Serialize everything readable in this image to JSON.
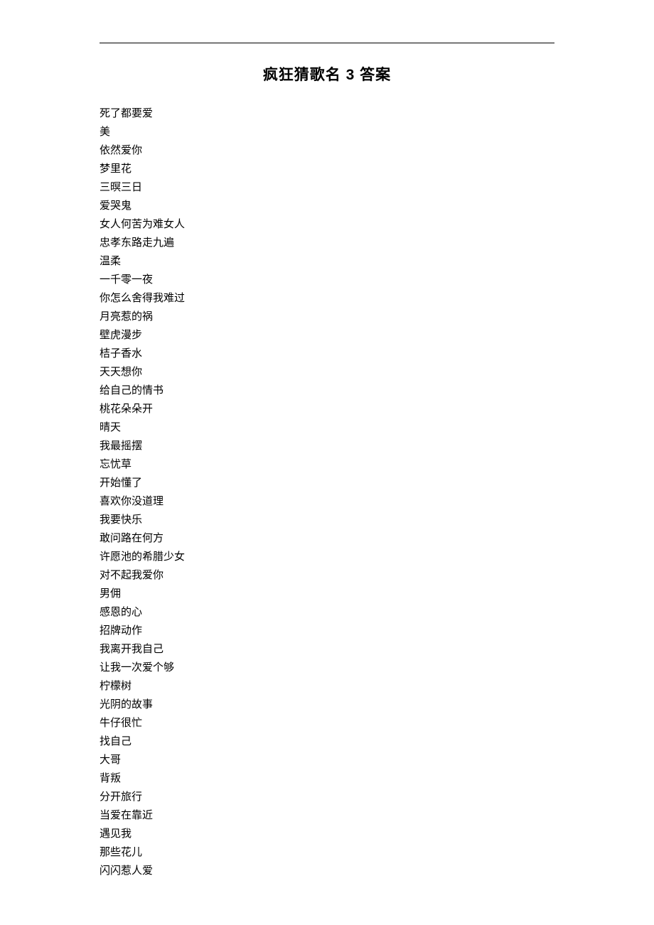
{
  "title": "疯狂猜歌名 3 答案",
  "songs": [
    "死了都要爱",
    "美",
    "依然爱你",
    "梦里花",
    "三暝三日",
    "爱哭鬼",
    "女人何苦为难女人",
    "忠孝东路走九遍",
    "温柔",
    "一千零一夜",
    "你怎么舍得我难过",
    "月亮惹的祸",
    "壁虎漫步",
    "桔子香水",
    "天天想你",
    "给自己的情书",
    "桃花朵朵开",
    "晴天",
    "我最摇摆",
    "忘忧草",
    "开始懂了",
    "喜欢你没道理",
    "我要快乐",
    "敢问路在何方",
    "许愿池的希腊少女",
    "对不起我爱你",
    "男佣",
    "感恩的心",
    "招牌动作",
    "我离开我自己",
    "让我一次爱个够",
    "柠檬树",
    "光阴的故事",
    "牛仔很忙",
    "找自己",
    "大哥",
    "背叛",
    "分开旅行",
    "当爱在靠近",
    "遇见我",
    "那些花儿",
    "闪闪惹人爱"
  ]
}
